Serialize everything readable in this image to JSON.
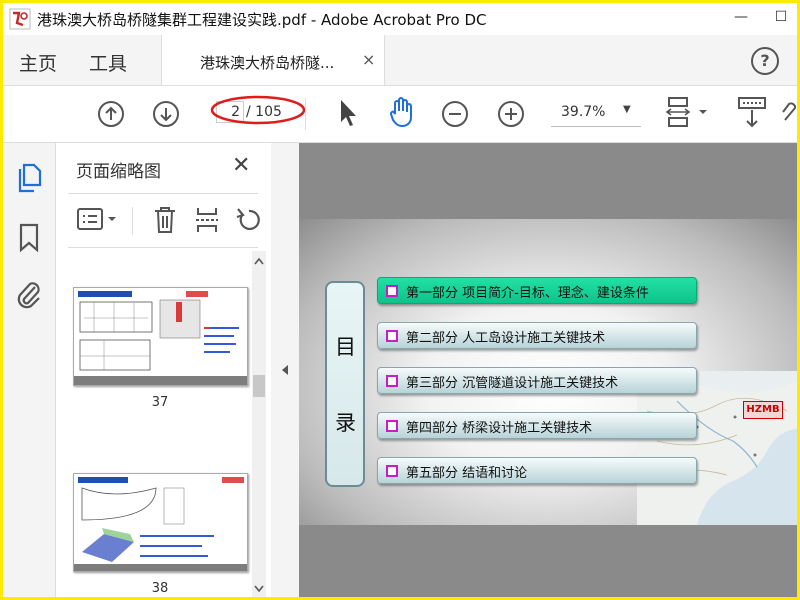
{
  "window": {
    "title": "港珠澳大桥岛桥隧集群工程建设实践.pdf - Adobe Acrobat Pro DC",
    "logo_text": "荷雨",
    "controls": {
      "minimize": "—",
      "maximize": "☐"
    }
  },
  "tabs": {
    "home": "主页",
    "tools": "工具",
    "document": "港珠澳大桥岛桥隧...",
    "close": "×",
    "help": "?"
  },
  "toolbar": {
    "page_current": "2",
    "page_total": "/ 105",
    "zoom": "39.7%",
    "zoom_caret": "▼",
    "annotation_color": "#e01b1b"
  },
  "panel": {
    "title": "页面缩略图",
    "close": "✕",
    "thumbnails": [
      {
        "page": "37",
        "header": "整体施工方案",
        "tag": "侧帆设计"
      },
      {
        "page": "38",
        "header": "起始节段施工",
        "tag": "侧帆设计"
      }
    ]
  },
  "slide": {
    "toc_chars": [
      "目",
      "录"
    ],
    "items": [
      {
        "label": "第一部分 项目简介-目标、理念、建设条件",
        "active": true
      },
      {
        "label": "第二部分 人工岛设计施工关键技术",
        "active": false
      },
      {
        "label": "第三部分 沉管隧道设计施工关键技术",
        "active": false
      },
      {
        "label": "第四部分 桥梁设计施工关键技术",
        "active": false
      },
      {
        "label": "第五部分 结语和讨论",
        "active": false
      }
    ],
    "map_label": "HZMB",
    "colors": {
      "active": "#0ec38a",
      "bullet": "#c81cc8",
      "item": "#b8d3d8"
    }
  }
}
